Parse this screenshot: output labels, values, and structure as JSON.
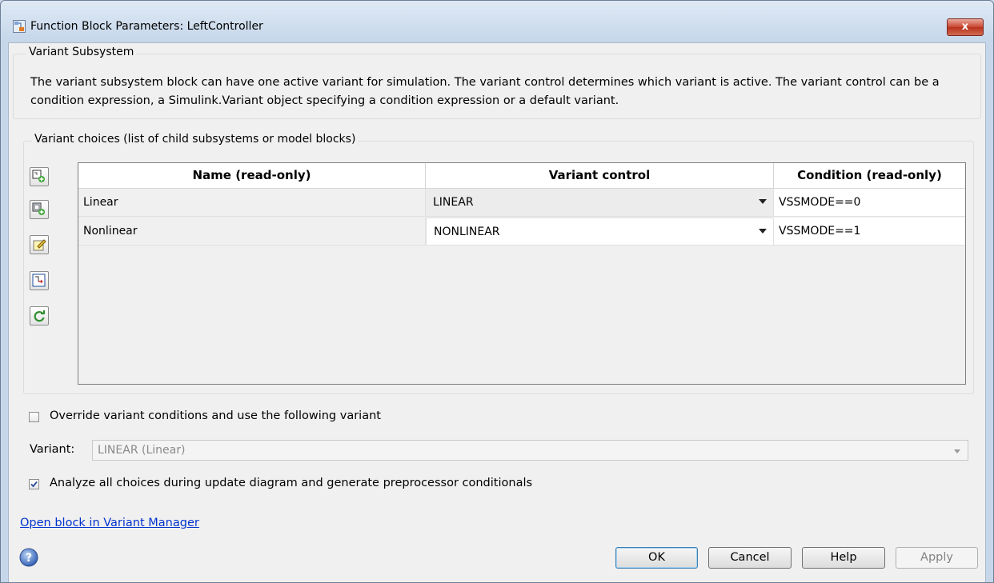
{
  "window": {
    "title": "Function Block Parameters: LeftController",
    "close_label": "x"
  },
  "variant_subsystem": {
    "legend": "Variant Subsystem",
    "description": "The variant subsystem block can have one active variant for simulation. The variant control determines which variant is active. The variant control can be a condition expression, a Simulink.Variant object specifying a condition expression or a default variant."
  },
  "choices": {
    "legend": "Variant choices (list of child subsystems or model blocks)",
    "toolbar": [
      "add-subsystem-choice-icon",
      "add-model-choice-icon",
      "edit-icon",
      "open-block-icon",
      "refresh-icon"
    ],
    "columns": [
      "Name (read-only)",
      "Variant control",
      "Condition (read-only)"
    ],
    "rows": [
      {
        "name": "Linear",
        "control": "LINEAR",
        "condition": "VSSMODE==0"
      },
      {
        "name": "Nonlinear",
        "control": "NONLINEAR",
        "condition": "VSSMODE==1"
      }
    ]
  },
  "override": {
    "label": "Override variant conditions and use the following variant",
    "checked": false
  },
  "variant": {
    "label": "Variant:",
    "value": "LINEAR (Linear)"
  },
  "analyze": {
    "label": "Analyze all choices during update diagram and generate preprocessor conditionals",
    "checked": true
  },
  "link": "Open block in Variant Manager",
  "buttons": {
    "ok": "OK",
    "cancel": "Cancel",
    "help": "Help",
    "apply": "Apply"
  },
  "colors": {
    "link": "#0033cc",
    "title_gradient": "#c6d7ea",
    "close_button": "#c9452f"
  }
}
